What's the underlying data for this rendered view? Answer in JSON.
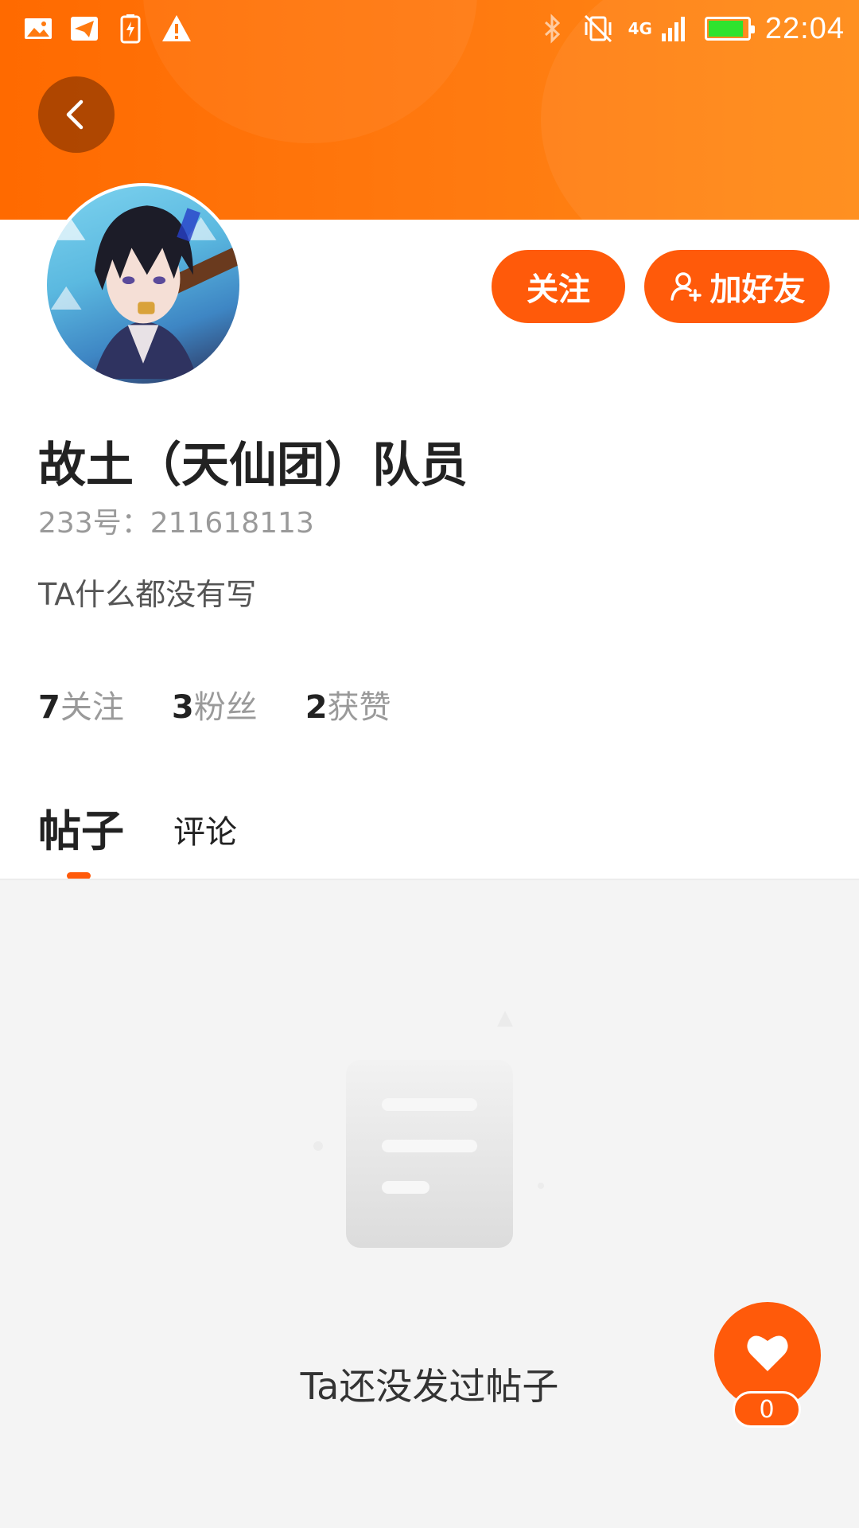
{
  "status_bar": {
    "time": "22:04",
    "network": "4G",
    "left_icons": [
      "image-icon",
      "send-icon",
      "battery-saver-icon",
      "warning-icon"
    ],
    "right_icons": [
      "bluetooth-icon",
      "vibrate-off-icon",
      "signal-icon",
      "battery-icon"
    ],
    "battery_level": 0.9
  },
  "header": {
    "back_icon": "chevron-left-icon",
    "accent_color": "#ff5a0a"
  },
  "profile": {
    "name": "故土（天仙团）队员",
    "id_text": "233号：211618113",
    "bio": "TA什么都没有写",
    "follow_label": "关注",
    "add_friend_label": "加好友"
  },
  "stats": [
    {
      "count": "7",
      "label": "关注"
    },
    {
      "count": "3",
      "label": "粉丝"
    },
    {
      "count": "2",
      "label": "获赞"
    }
  ],
  "tabs": [
    {
      "label": "帖子",
      "active": true
    },
    {
      "label": "评论",
      "active": false
    }
  ],
  "empty_state": {
    "text": "Ta还没发过帖子",
    "icon": "document-icon"
  },
  "like": {
    "count": "0",
    "icon": "heart-icon"
  }
}
